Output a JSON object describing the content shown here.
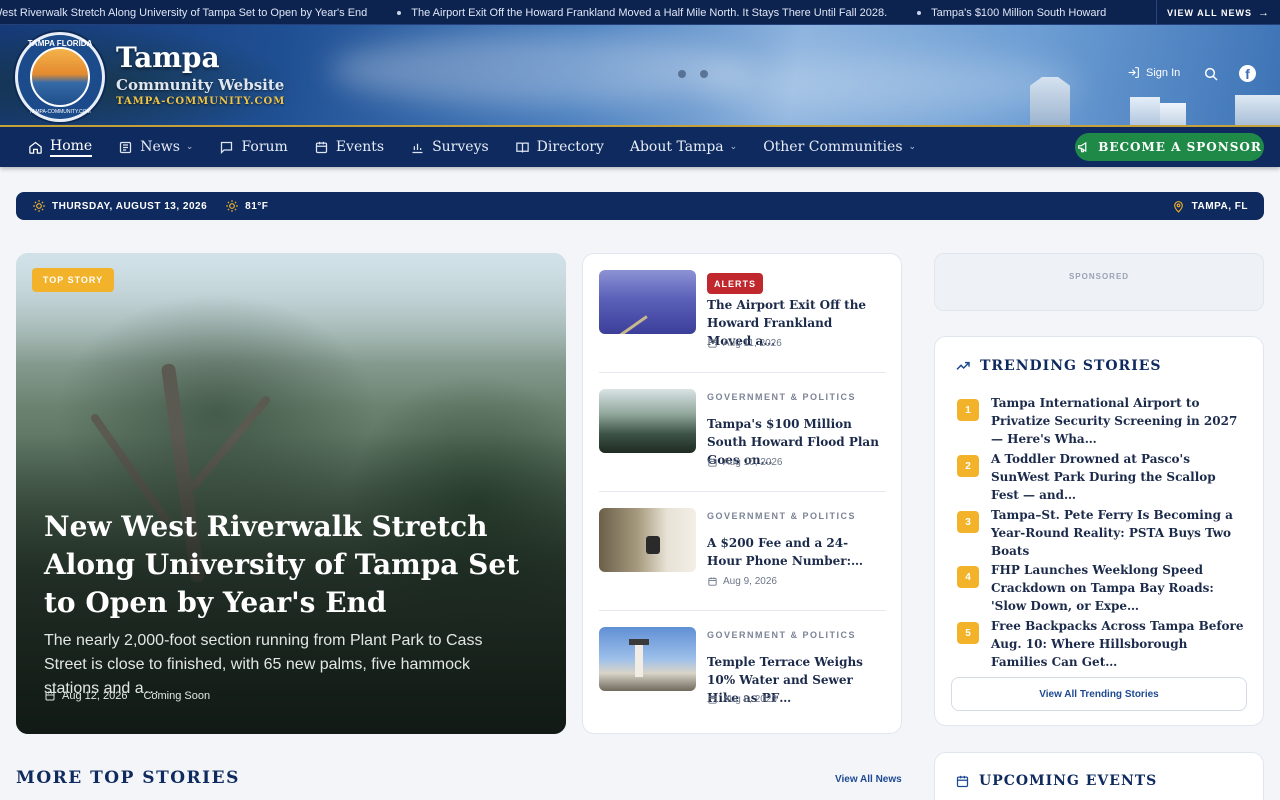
{
  "ticker": {
    "items": [
      "West Riverwalk Stretch Along University of Tampa Set to Open by Year's End",
      "The Airport Exit Off the Howard Frankland Moved a Half Mile North. It Stays There Until Fall 2028.",
      "Tampa's $100 Million South Howard"
    ],
    "view_all": "VIEW ALL NEWS"
  },
  "header": {
    "logo_top": "TAMPA FLORIDA",
    "logo_bottom": "TAMPA-COMMUNITY.COM",
    "title": "Tampa",
    "subtitle": "Community Website",
    "url": "TAMPA-COMMUNITY.COM",
    "sign_in": "Sign In"
  },
  "nav": {
    "items": [
      {
        "label": "Home",
        "icon": "home-icon"
      },
      {
        "label": "News",
        "icon": "newspaper-icon"
      },
      {
        "label": "Forum",
        "icon": "chat-icon"
      },
      {
        "label": "Events",
        "icon": "calendar-icon"
      },
      {
        "label": "Surveys",
        "icon": "bar-chart-icon"
      },
      {
        "label": "Directory",
        "icon": "book-icon"
      },
      {
        "label": "About Tampa"
      },
      {
        "label": "Other Communities"
      }
    ],
    "sponsor": "BECOME A SPONSOR"
  },
  "datebar": {
    "date": "THURSDAY, AUGUST 13, 2026",
    "temp": "81°F",
    "location": "TAMPA, FL"
  },
  "hero": {
    "badge": "TOP STORY",
    "title": "New West Riverwalk Stretch Along University of Tampa Set to Open by Year's End",
    "description": "The nearly 2,000-foot section running from Plant Park to Cass Street is close to finished, with 65 new palms, five hammock stations and a…",
    "date": "Aug 12, 2026",
    "tag": "Coming Soon"
  },
  "stories": [
    {
      "category": "ALERTS",
      "title": "The Airport Exit Off the Howard Frankland Moved a…",
      "date": "Aug 11, 2026"
    },
    {
      "category": "GOVERNMENT & POLITICS",
      "title": "Tampa's $100 Million South Howard Flood Plan Goes on…",
      "date": "Aug 10, 2026"
    },
    {
      "category": "GOVERNMENT & POLITICS",
      "title": "A $200 Fee and a 24-Hour Phone Number:…",
      "date": "Aug 9, 2026"
    },
    {
      "category": "GOVERNMENT & POLITICS",
      "title": "Temple Terrace Weighs 10% Water and Sewer Hike as PF…",
      "date": "Aug 8, 2026"
    }
  ],
  "sponsored": "SPONSORED",
  "trending": {
    "heading": "TRENDING STORIES",
    "items": [
      {
        "rank": "1",
        "title": "Tampa International Airport to Privatize Security Screening in 2027 — Here's Wha…"
      },
      {
        "rank": "2",
        "title": "A Toddler Drowned at Pasco's SunWest Park During the Scallop Fest — and…"
      },
      {
        "rank": "3",
        "title": "Tampa–St. Pete Ferry Is Becoming a Year-Round Reality: PSTA Buys Two Boats"
      },
      {
        "rank": "4",
        "title": "FHP Launches Weeklong Speed Crackdown on Tampa Bay Roads: 'Slow Down, or Expe…"
      },
      {
        "rank": "5",
        "title": "Free Backpacks Across Tampa Before Aug. 10: Where Hillsborough Families Can Get…"
      }
    ],
    "view_all": "View All Trending Stories"
  },
  "more_top_stories": {
    "heading": "MORE TOP STORIES",
    "link": "View All News"
  },
  "upcoming_events": {
    "heading": "UPCOMING EVENTS"
  },
  "colors": {
    "navy": "#0f2a5e",
    "gold": "#f2b32a",
    "green": "#1f8a48",
    "alert_red": "#c0282d"
  }
}
